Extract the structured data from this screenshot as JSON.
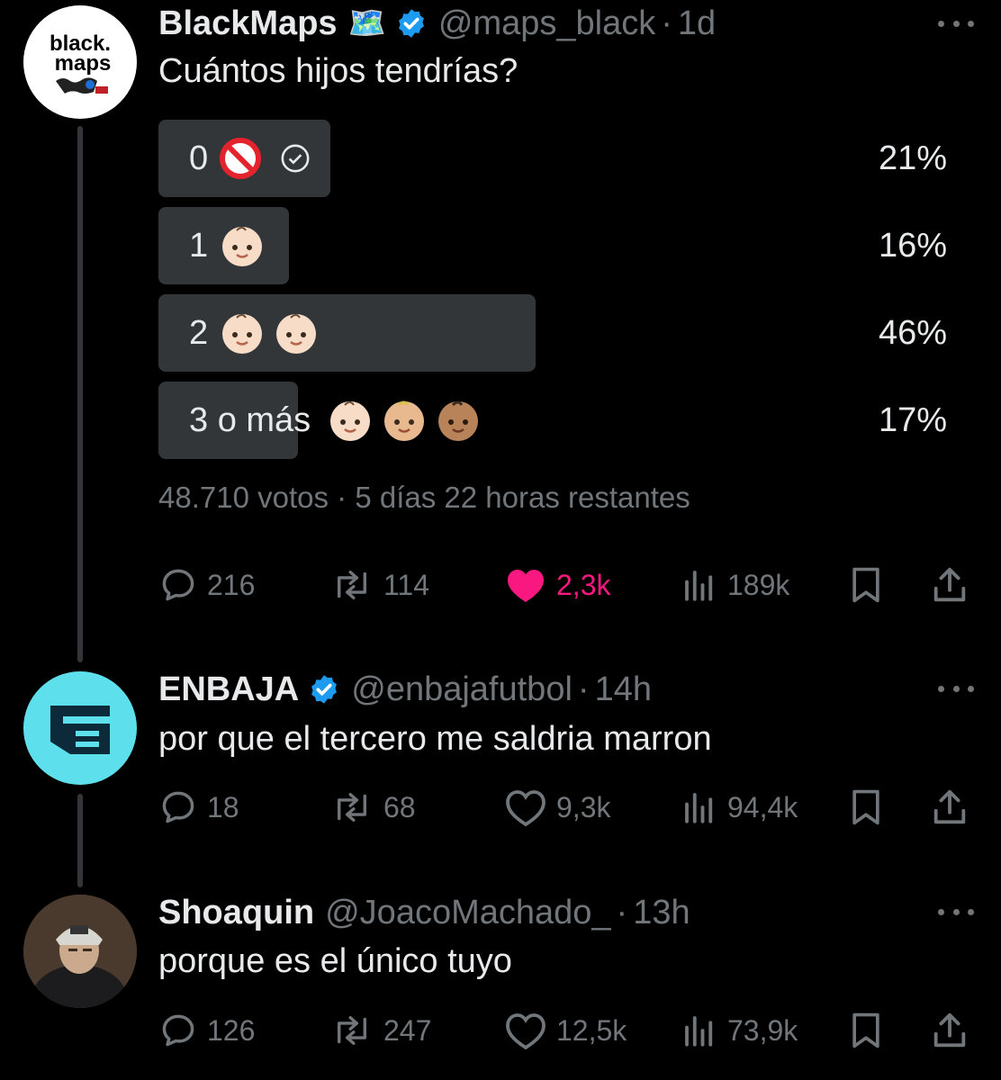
{
  "colors": {
    "background": "#000000",
    "text": "#e7e9ea",
    "muted": "#71767b",
    "like": "#f91880",
    "verified": "#1d9bf0",
    "poll_fill": "#333639"
  },
  "tweets": [
    {
      "avatar_text": "black.\nmaps",
      "name": "BlackMaps",
      "name_emoji": "🗺️",
      "handle": "@maps_black",
      "time": "1d",
      "text": "Cuántos hijos tendrías?",
      "poll": {
        "options": [
          {
            "label": "0 🚫",
            "pct": "21%",
            "value": 21,
            "selected": true
          },
          {
            "label": "1 👶🏻",
            "pct": "16%",
            "value": 16
          },
          {
            "label": "2 👶🏻👶🏻",
            "pct": "46%",
            "value": 46
          },
          {
            "label": "3 o más 👶🏻👶🏼👶🏽",
            "pct": "17%",
            "value": 17
          }
        ],
        "votes": "48.710 votos",
        "remaining": "5 días 22 horas restantes"
      },
      "stats": {
        "replies": "216",
        "retweets": "114",
        "likes": "2,3k",
        "views": "189k",
        "liked": true
      }
    },
    {
      "name": "ENBAJA",
      "handle": "@enbajafutbol",
      "time": "14h",
      "text": "por que el tercero me saldria marron",
      "stats": {
        "replies": "18",
        "retweets": "68",
        "likes": "9,3k",
        "views": "94,4k",
        "liked": false
      }
    },
    {
      "name": "Shoaquin",
      "handle": "@JoacoMachado_",
      "time": "13h",
      "text": "porque es el único tuyo",
      "stats": {
        "replies": "126",
        "retweets": "247",
        "likes": "12,5k",
        "views": "73,9k",
        "liked": false
      }
    }
  ]
}
